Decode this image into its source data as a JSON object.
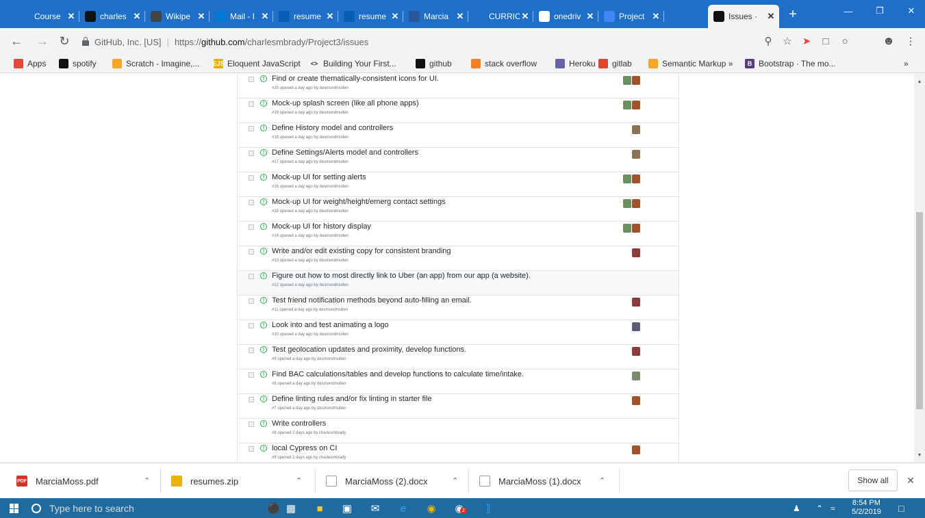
{
  "browser": {
    "tabs": [
      {
        "title": "Course",
        "favicon": "doc-icon",
        "color": "#1d6fc9"
      },
      {
        "title": "charles",
        "favicon": "github-icon",
        "color": "#111"
      },
      {
        "title": "Wikipe",
        "favicon": "wikipedia-icon",
        "color": "#444"
      },
      {
        "title": "Mail - I",
        "favicon": "outlook-icon",
        "color": "#0078d4"
      },
      {
        "title": "resume",
        "favicon": "onedrive-icon",
        "color": "#0a5db5"
      },
      {
        "title": "resume",
        "favicon": "onedrive-icon",
        "color": "#0a5db5"
      },
      {
        "title": "Marcia",
        "favicon": "word-icon",
        "color": "#2b579a"
      },
      {
        "title": "CURRIC",
        "favicon": "doc-icon",
        "color": "#1d6fc9"
      },
      {
        "title": "onedriv",
        "favicon": "google-icon",
        "color": "#fff"
      },
      {
        "title": "Project",
        "favicon": "docs-icon",
        "color": "#4285f4"
      },
      {
        "title": "Issues ·",
        "favicon": "github-icon",
        "color": "#111",
        "active": true
      }
    ],
    "new_tab": "+",
    "url_org": "GitHub, Inc. [US]",
    "url_scheme": "https://",
    "url_host": "github.com",
    "url_path": "/charlesmbrady/Project3/issues",
    "bookmarks": [
      {
        "label": "Apps",
        "icon": "apps-grid-icon",
        "color": "#e8453c"
      },
      {
        "label": "spotify",
        "icon": "spotify-icon",
        "color": "#111"
      },
      {
        "label": "Scratch - Imagine,...",
        "icon": "scratch-icon",
        "color": "#f5a623"
      },
      {
        "label": "Eloquent JavaScript",
        "icon": "ejs-icon",
        "color": "#e6b012",
        "glyph": "EJS"
      },
      {
        "label": "Building Your First...",
        "icon": "code-icon",
        "color": "#f1f3f4",
        "glyph": "<>"
      },
      {
        "label": "github",
        "icon": "github-icon",
        "color": "#111"
      },
      {
        "label": "stack overflow",
        "icon": "stackoverflow-icon",
        "color": "#f48024"
      },
      {
        "label": "Heroku",
        "icon": "heroku-icon",
        "color": "#6762a6"
      },
      {
        "label": "gitlab",
        "icon": "gitlab-icon",
        "color": "#e24329"
      },
      {
        "label": "Semantic Markup »",
        "icon": "semantic-icon",
        "color": "#f5a623"
      },
      {
        "label": "Bootstrap · The mo...",
        "icon": "bootstrap-icon",
        "color": "#563d7c",
        "glyph": "B"
      }
    ],
    "more_bookmarks": "»"
  },
  "issues": [
    {
      "title": "Find or create thematically-consistent icons for UI.",
      "meta": "#20 opened a day ago by desmondmullen",
      "avatars": [
        "#6b8f5e",
        "#a0522d"
      ]
    },
    {
      "title": "Mock-up splash screen (like all phone apps)",
      "meta": "#19 opened a day ago by desmondmullen",
      "avatars": [
        "#6b8f5e",
        "#a0522d"
      ]
    },
    {
      "title": "Define History model and controllers",
      "meta": "#18 opened a day ago by desmondmullen",
      "avatars": [
        "#8b7355"
      ]
    },
    {
      "title": "Define Settings/Alerts model and controllers",
      "meta": "#17 opened a day ago by desmondmullen",
      "avatars": [
        "#8b7355"
      ]
    },
    {
      "title": "Mock-up UI for setting alerts",
      "meta": "#16 opened a day ago by desmondmullen",
      "avatars": [
        "#6b8f5e",
        "#a0522d"
      ]
    },
    {
      "title": "Mock-up UI for weight/height/emerg contact settings",
      "meta": "#15 opened a day ago by desmondmullen",
      "avatars": [
        "#6b8f5e",
        "#a0522d"
      ]
    },
    {
      "title": "Mock-up UI for history display",
      "meta": "#14 opened a day ago by desmondmullen",
      "avatars": [
        "#6b8f5e",
        "#a0522d"
      ]
    },
    {
      "title": "Write and/or edit existing copy for consistent branding",
      "meta": "#13 opened a day ago by desmondmullen",
      "avatars": [
        "#8a3b3b"
      ]
    },
    {
      "title": "Figure out how to most directly link to Uber (an app) from our app (a website).",
      "meta": "#12 opened a day ago by desmondmullen",
      "avatars": [],
      "highlight": true
    },
    {
      "title": "Test friend notification methods beyond auto-filling an email.",
      "meta": "#11 opened a day ago by desmondmullen",
      "avatars": [
        "#8a3b3b"
      ]
    },
    {
      "title": "Look into and test animating a logo",
      "meta": "#10 opened a day ago by desmondmullen",
      "avatars": [
        "#5a5a7a"
      ]
    },
    {
      "title": "Test geolocation updates and proximity, develop functions.",
      "meta": "#9 opened a day ago by desmondmullen",
      "avatars": [
        "#8a3b3b"
      ]
    },
    {
      "title": "Find BAC calculations/tables and develop functions to calculate time/intake.",
      "meta": "#8 opened a day ago by desmondmullen",
      "avatars": [
        "#7a8a6a"
      ]
    },
    {
      "title": "Define linting rules and/or fix linting in starter file",
      "meta": "#7 opened a day ago by desmondmullen",
      "avatars": [
        "#a0522d"
      ]
    },
    {
      "title": "Write controllers",
      "meta": "#6 opened 2 days ago by charlesmbrady",
      "avatars": []
    },
    {
      "title": "local Cypress on CI",
      "meta": "#5 opened 2 days ago by charlesmbrady",
      "avatars": [
        "#a0522d"
      ]
    }
  ],
  "downloads": [
    {
      "name": "MarciaMoss.pdf",
      "icon": "pdf-icon",
      "glyph": "PDF",
      "color": "#d93025"
    },
    {
      "name": "resumes.zip",
      "icon": "zip-icon",
      "glyph": "",
      "color": "#e8b400"
    },
    {
      "name": "MarciaMoss (2).docx",
      "icon": "document-icon",
      "glyph": "",
      "color": "#fff"
    },
    {
      "name": "MarciaMoss (1).docx",
      "icon": "document-icon",
      "glyph": "",
      "color": "#fff"
    }
  ],
  "show_all": "Show all",
  "taskbar": {
    "search_placeholder": "Type here to search",
    "time": "8:54 PM",
    "date": "5/2/2019",
    "chrome_badge": "2"
  }
}
